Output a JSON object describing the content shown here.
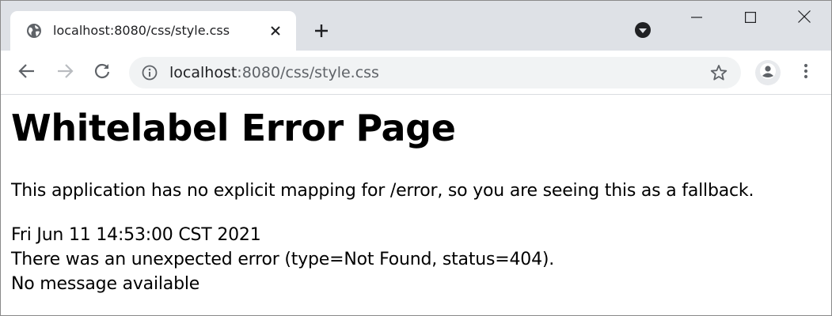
{
  "tab": {
    "title": "localhost:8080/css/style.css",
    "favicon": "globe-icon"
  },
  "window_controls": {
    "minimize": "minimize-icon",
    "maximize": "maximize-icon",
    "close": "close-icon"
  },
  "toolbar": {
    "url_host": "localhost",
    "url_rest": ":8080/css/style.css"
  },
  "page": {
    "heading": "Whitelabel Error Page",
    "description": "This application has no explicit mapping for /error, so you are seeing this as a fallback.",
    "timestamp": "Fri Jun 11 14:53:00 CST 2021",
    "error_line": "There was an unexpected error (type=Not Found, status=404).",
    "message": "No message available"
  },
  "colors": {
    "tabstrip": "#dee1e6",
    "omnibox": "#f1f3f4",
    "icon": "#5f6368"
  }
}
